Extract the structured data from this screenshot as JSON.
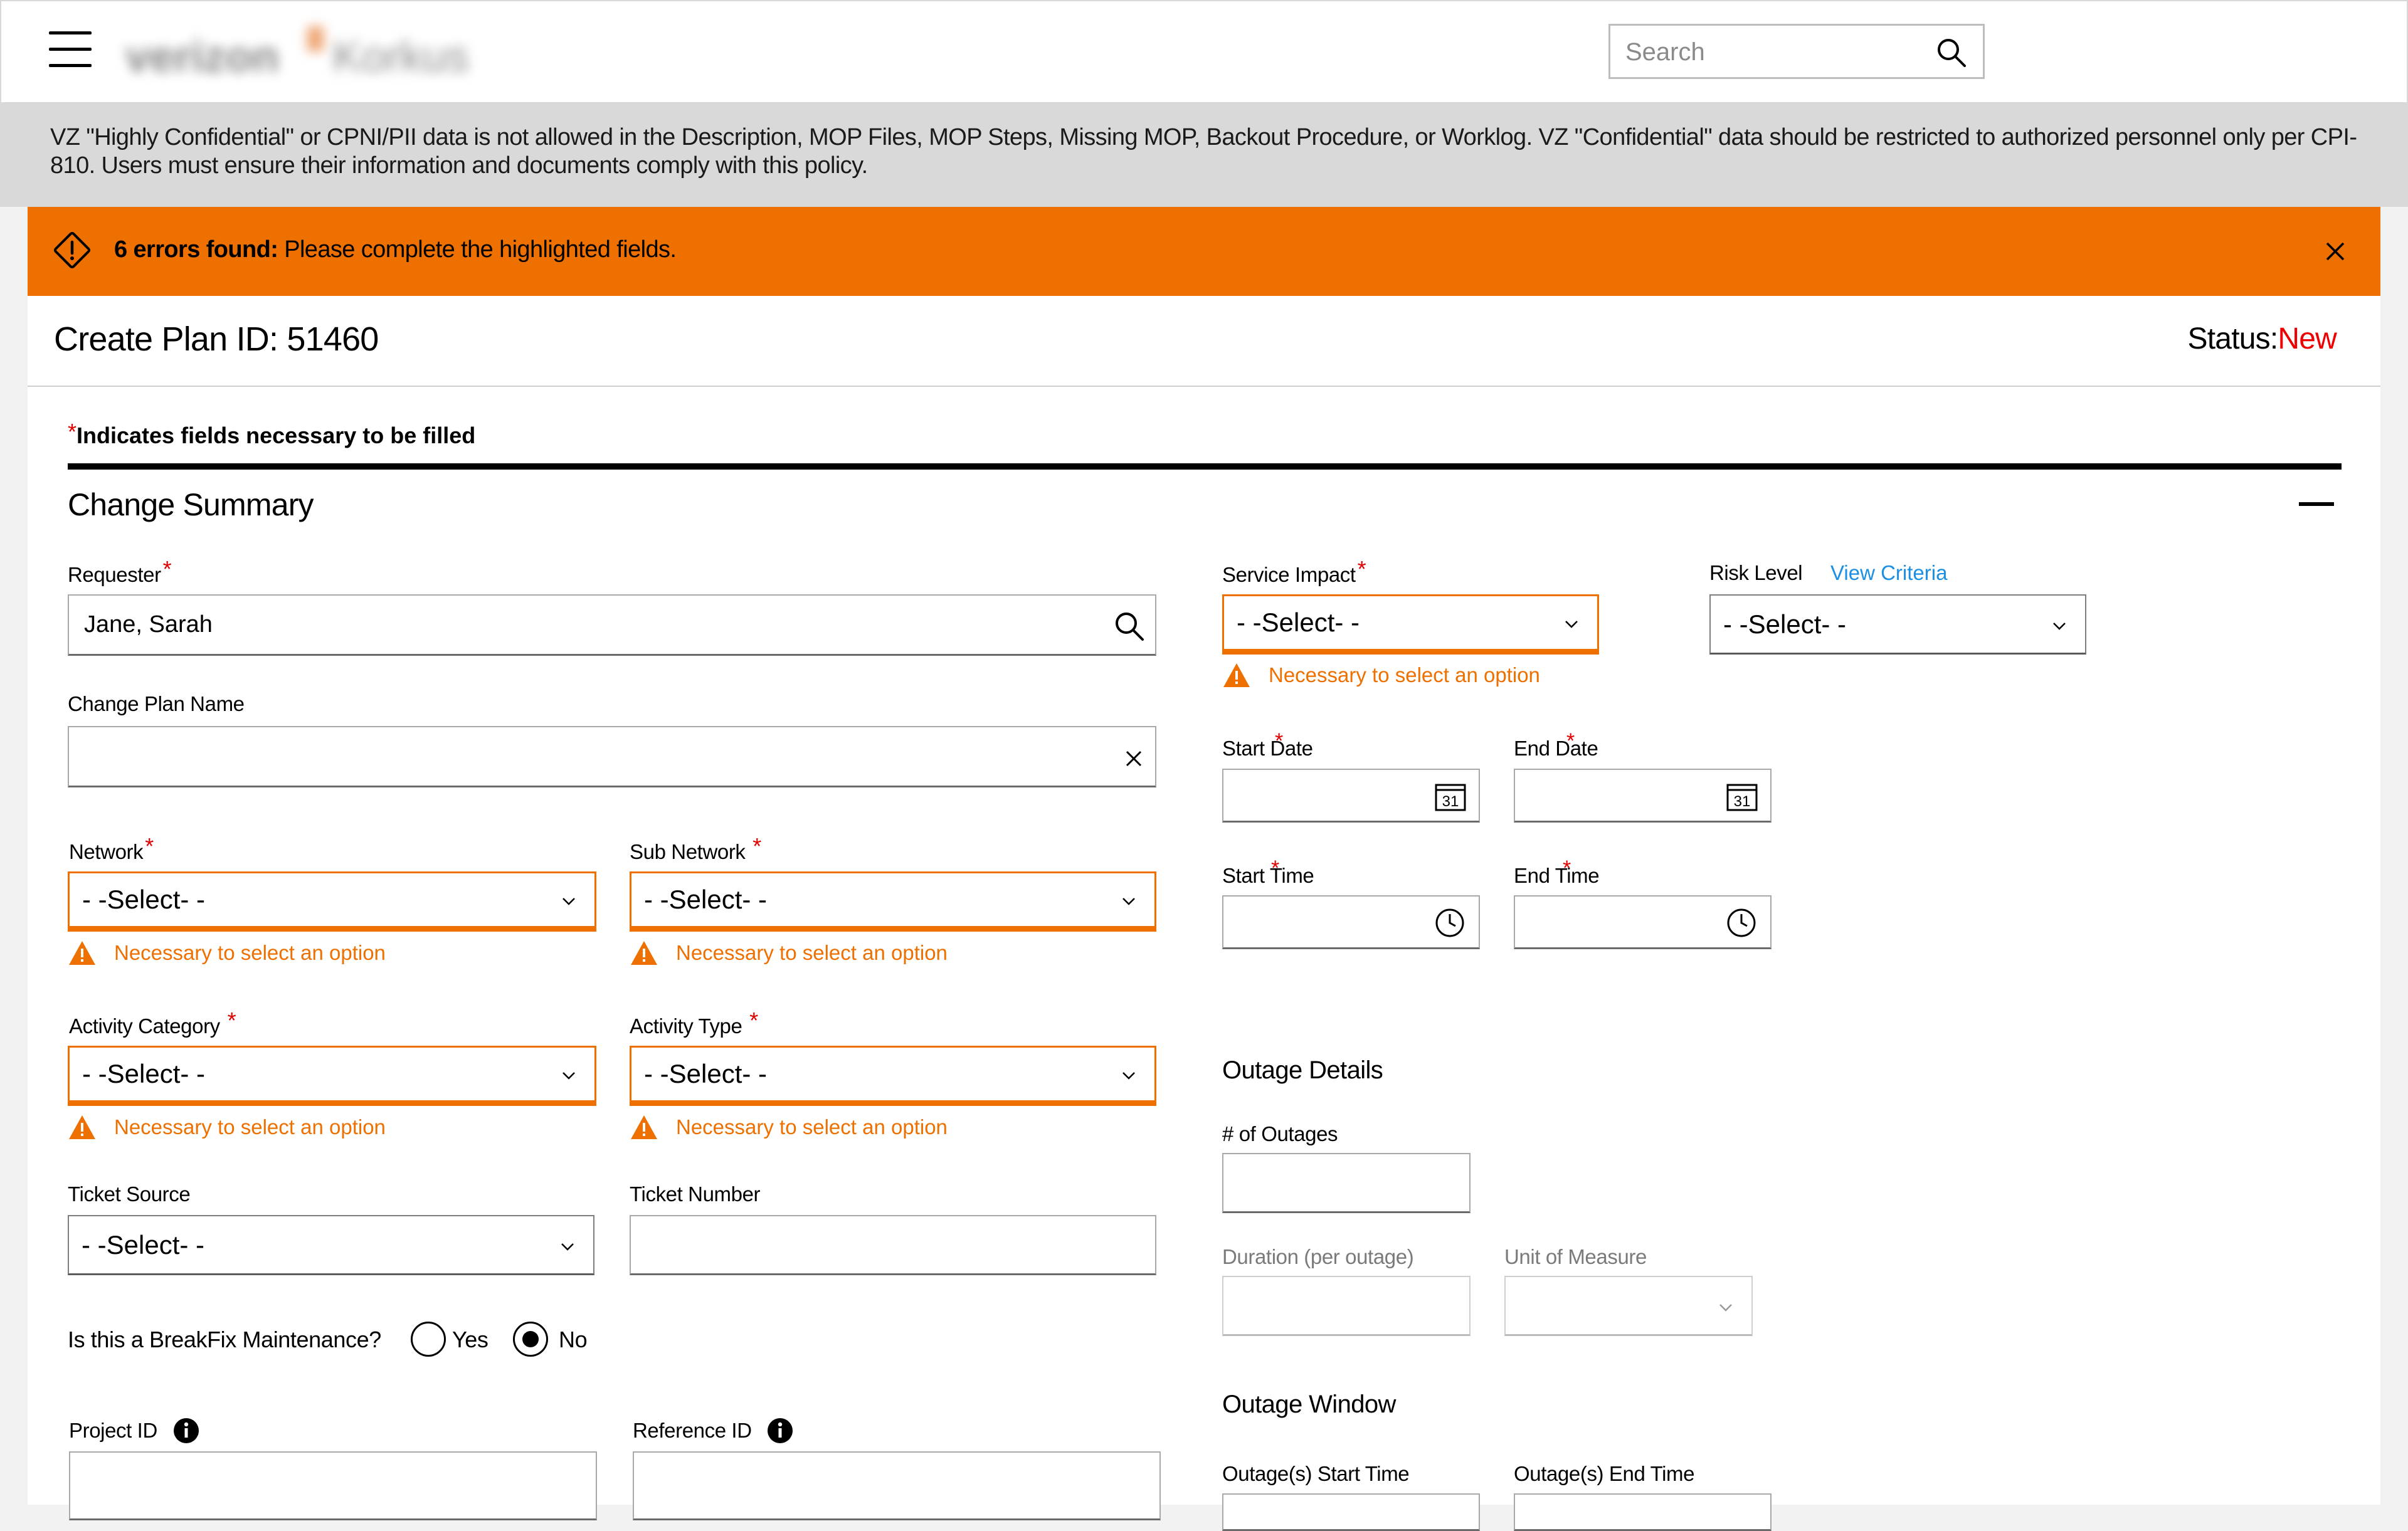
{
  "header": {
    "logo_text": "verizon",
    "logo_suffix": "Korkus",
    "search_placeholder": "Search"
  },
  "policy_notice": "VZ \"Highly Confidential\" or CPNI/PII data is not allowed in the Description, MOP Files, MOP Steps, Missing MOP, Backout Procedure, or Worklog. VZ \"Confidential\" data should be restricted to authorized personnel only per CPI-810. Users must ensure their information and documents comply with this policy.",
  "error_banner": {
    "count_text": "6 errors found:",
    "message": "Please complete the highlighted fields."
  },
  "plan": {
    "title": "Create Plan ID: 51460",
    "status_label": "Status:",
    "status_value": "New",
    "status_color": "#ee0000"
  },
  "required_note": "Indicates fields necessary to be filled",
  "required_mark": "*",
  "section": {
    "title": "Change Summary"
  },
  "fields": {
    "requester": {
      "label": "Requester",
      "value": "Jane, Sarah"
    },
    "change_plan_name": {
      "label": "Change Plan Name",
      "value": ""
    },
    "network": {
      "label": "Network",
      "value": "- -Select- -"
    },
    "sub_network": {
      "label": "Sub Network",
      "value": "- -Select- -"
    },
    "activity_category": {
      "label": "Activity Category",
      "value": "- -Select- -"
    },
    "activity_type": {
      "label": "Activity Type",
      "value": "- -Select- -"
    },
    "ticket_source": {
      "label": "Ticket Source",
      "value": "- -Select- -"
    },
    "ticket_number": {
      "label": "Ticket Number",
      "value": ""
    },
    "breakfix": {
      "label": "Is this a BreakFix Maintenance?",
      "yes": "Yes",
      "no": "No",
      "selected": "No"
    },
    "project_id": {
      "label": "Project ID"
    },
    "reference_id": {
      "label": "Reference ID"
    },
    "service_impact": {
      "label": "Service Impact",
      "value": "- -Select- -"
    },
    "risk_level": {
      "label": "Risk Level",
      "value": "- -Select- -",
      "link": "View Criteria"
    },
    "start_date": {
      "label": "Start Date",
      "calendar_day": "31"
    },
    "end_date": {
      "label": "End Date",
      "calendar_day": "31"
    },
    "start_time": {
      "label": "Start Time"
    },
    "end_time": {
      "label": "End Time"
    }
  },
  "error_text": "Necessary to select an option",
  "outage_details": {
    "title": "Outage Details",
    "num_outages": "# of Outages",
    "duration": "Duration (per outage)",
    "unit": "Unit of Measure"
  },
  "outage_window": {
    "title": "Outage Window",
    "start": "Outage(s) Start Time",
    "end": "Outage(s) End Time"
  },
  "colors": {
    "accent": "#ed7000",
    "error": "#ee0000",
    "link": "#1a8fe3",
    "banner_gray": "#d9d9d9"
  },
  "icons": [
    "menu-icon",
    "search-icon",
    "warning-diamond-icon",
    "close-icon",
    "collapse-icon",
    "chevron-down-icon",
    "warning-triangle-icon",
    "clear-icon",
    "calendar-icon",
    "clock-icon",
    "info-icon"
  ]
}
